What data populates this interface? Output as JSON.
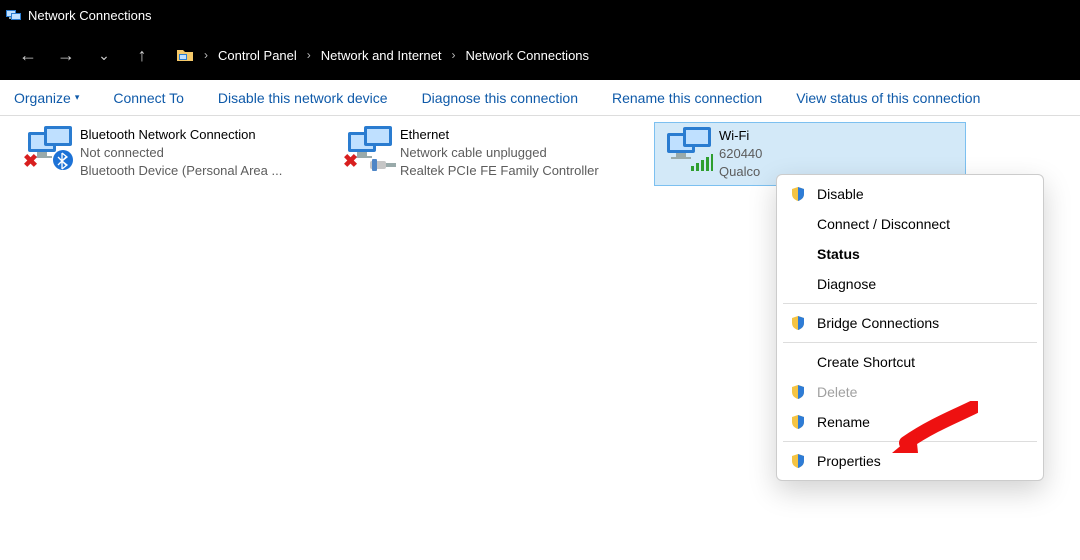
{
  "window": {
    "title": "Network Connections"
  },
  "breadcrumb": {
    "items": [
      "Control Panel",
      "Network and Internet",
      "Network Connections"
    ]
  },
  "commands": {
    "organize": "Organize",
    "connect_to": "Connect To",
    "disable": "Disable this network device",
    "diagnose": "Diagnose this connection",
    "rename": "Rename this connection",
    "view_status": "View status of this connection"
  },
  "connections": [
    {
      "name": "Bluetooth Network Connection",
      "status": "Not connected",
      "device": "Bluetooth Device (Personal Area ..."
    },
    {
      "name": "Ethernet",
      "status": "Network cable unplugged",
      "device": "Realtek PCIe FE Family Controller"
    },
    {
      "name": "Wi-Fi",
      "status": "620440",
      "device": "Qualco"
    }
  ],
  "context_menu": {
    "disable": "Disable",
    "connect_disconnect": "Connect / Disconnect",
    "status": "Status",
    "diagnose": "Diagnose",
    "bridge": "Bridge Connections",
    "create_shortcut": "Create Shortcut",
    "delete": "Delete",
    "rename": "Rename",
    "properties": "Properties"
  }
}
